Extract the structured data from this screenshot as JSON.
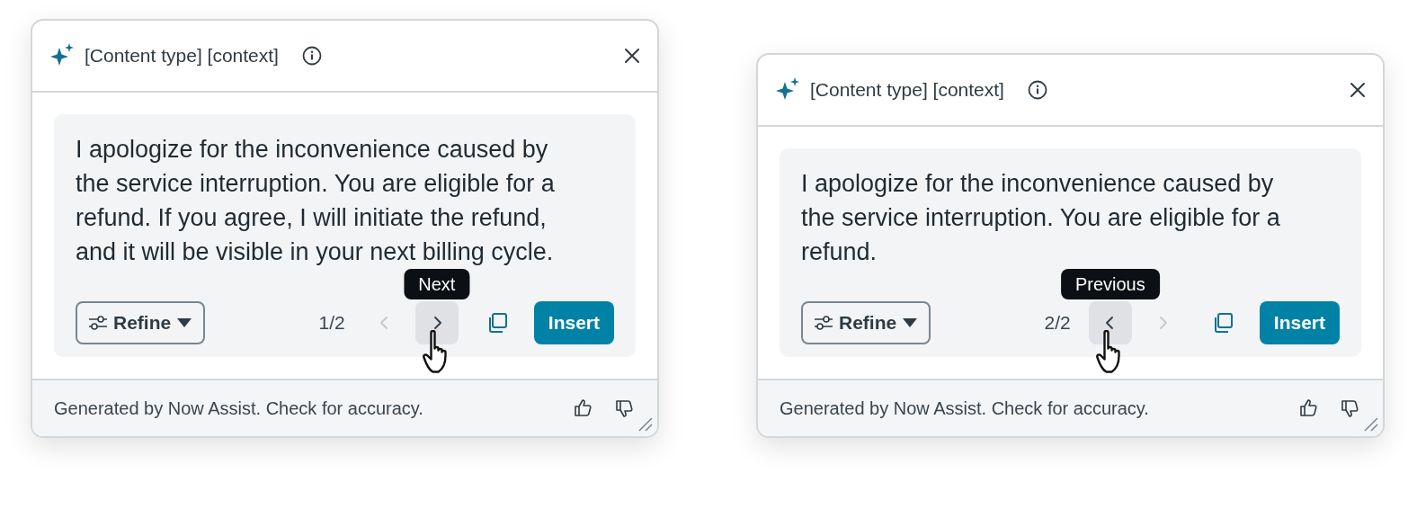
{
  "panels": [
    {
      "title": "[Content type] [context]",
      "body": "I apologize for the inconvenience caused by the service interruption. You are eligible for a refund. If you agree, I will initiate the refund, and it will be visible in your next billing cycle.",
      "refine": "Refine",
      "pager": "1/2",
      "prev": {
        "disabled": true,
        "hovered": false
      },
      "next": {
        "disabled": false,
        "hovered": true
      },
      "tooltip": "Next",
      "insert": "Insert",
      "footer": "Generated by Now Assist. Check for accuracy."
    },
    {
      "title": "[Content type] [context]",
      "body": "I apologize for the inconvenience caused by the service interruption. You are eligible for a refund.",
      "refine": "Refine",
      "pager": "2/2",
      "prev": {
        "disabled": false,
        "hovered": true
      },
      "next": {
        "disabled": true,
        "hovered": false
      },
      "tooltip": "Previous",
      "insert": "Insert",
      "footer": "Generated by Now Assist. Check for accuracy."
    }
  ]
}
